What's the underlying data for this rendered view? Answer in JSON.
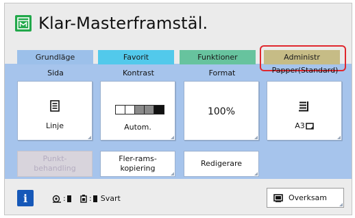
{
  "header": {
    "title": "Klar-Masterframstäl.",
    "icon": "master-icon"
  },
  "tabs": [
    {
      "label": "Grundläge",
      "color": "#9cc0ea"
    },
    {
      "label": "Favorit",
      "color": "#52c9eb"
    },
    {
      "label": "Funktioner",
      "color": "#67c39e"
    },
    {
      "label": "Administr",
      "color": "#c6bc86",
      "highlighted": true
    }
  ],
  "highlight_color": "#e0262d",
  "settings": {
    "sida": {
      "label": "Sida",
      "value": "Linje",
      "icon": "document-icon"
    },
    "kontrast": {
      "label": "Kontrast",
      "value": "Autom.",
      "level": 3,
      "max_level": 5
    },
    "format": {
      "label": "Format",
      "value": "100%"
    },
    "papper": {
      "label": "Papper(Standard)",
      "value": "A3",
      "icon": "paper-stack-icon"
    }
  },
  "buttons": {
    "punkt": "Punkt-\nbehandling",
    "fler_rams": "Fler-rams-\nkopiering",
    "redigerare": "Redigerare"
  },
  "status": {
    "info_label": "i",
    "drum_sep": ":",
    "ink_sep": ":",
    "ink_color": "Svart",
    "overksam": "Overksam"
  }
}
